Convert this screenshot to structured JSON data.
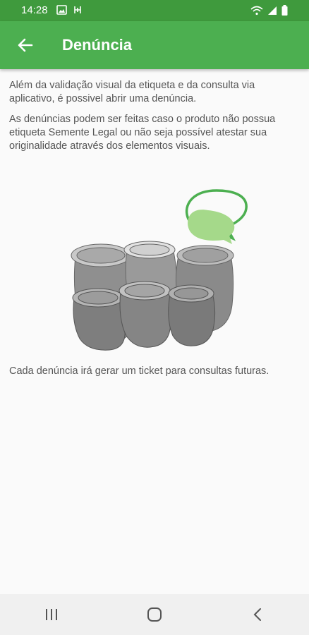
{
  "status": {
    "time": "14:28",
    "left_icons": [
      "image-icon",
      "signal-pulse-icon"
    ],
    "right_icons": [
      "wifi-icon",
      "cell-signal-icon",
      "battery-icon"
    ]
  },
  "appbar": {
    "back_icon": "arrow-back-icon",
    "title": "Denúncia"
  },
  "content": {
    "paragraph1": "Além da validação visual da etiqueta e da consulta via aplicativo, é possivel abrir uma denúncia.",
    "paragraph2": "As denúncias podem ser feitas caso o produto não possua etiqueta Semente Legal ou não seja possível atestar sua originalidade através dos elementos visuais.",
    "illustration": "seed-sacks-with-chat-bubbles",
    "accent_color": "#4caf50",
    "bubble_fill_color": "#a5d98a",
    "footer": "Cada denúncia irá gerar um ticket para consultas futuras."
  },
  "navbar": {
    "buttons": [
      "recent-apps-icon",
      "home-icon",
      "back-icon"
    ]
  }
}
